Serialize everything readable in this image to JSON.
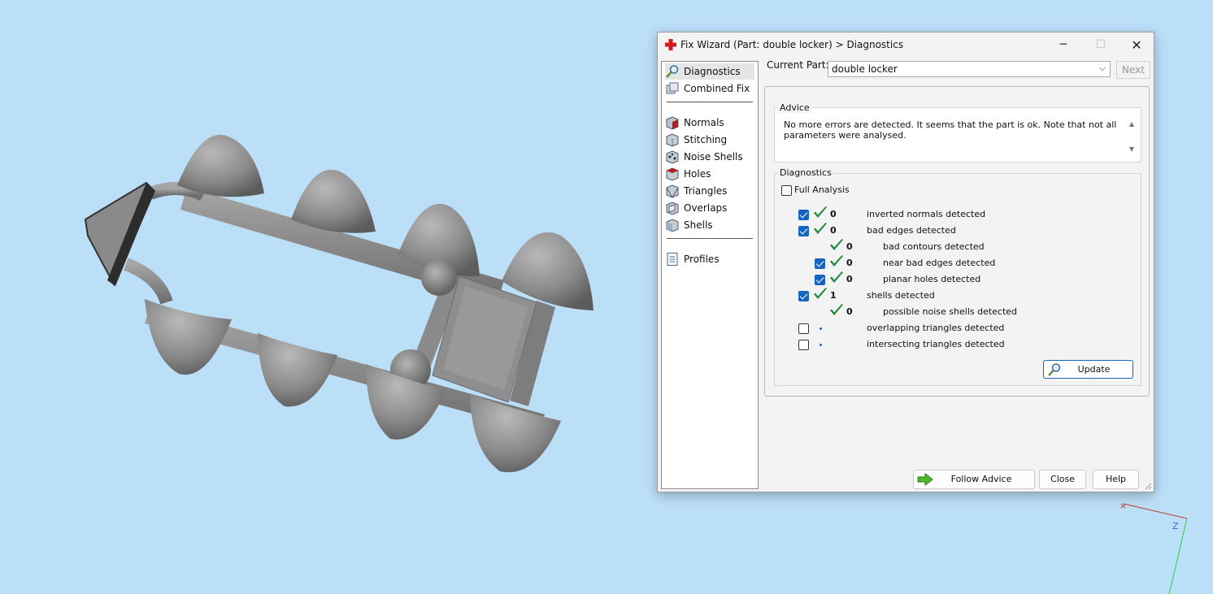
{
  "window": {
    "title": "Fix Wizard (Part: double locker) > Diagnostics",
    "app_icon": "red-cross-icon",
    "controls": {
      "minimize": "─",
      "maximize": "☐",
      "close": "✕"
    }
  },
  "sidebar": {
    "items": [
      {
        "label": "Diagnostics",
        "icon": "magnifier-icon",
        "selected": true
      },
      {
        "label": "Combined Fix",
        "icon": "combined-fix-icon"
      },
      {
        "label": "Normals",
        "icon": "normals-cube-icon"
      },
      {
        "label": "Stitching",
        "icon": "stitching-cube-icon"
      },
      {
        "label": "Noise Shells",
        "icon": "noise-shells-cube-icon"
      },
      {
        "label": "Holes",
        "icon": "holes-cube-icon"
      },
      {
        "label": "Triangles",
        "icon": "triangles-cube-icon"
      },
      {
        "label": "Overlaps",
        "icon": "overlaps-cube-icon"
      },
      {
        "label": "Shells",
        "icon": "shells-cube-icon"
      },
      {
        "label": "Profiles",
        "icon": "document-icon"
      }
    ]
  },
  "current_part": {
    "label": "Current Part:",
    "value": "double locker",
    "next_label": "Next"
  },
  "advice": {
    "title": "Advice",
    "text": "No more errors are detected. It seems that the part is ok. Note that not all parameters were analysed."
  },
  "diagnostics": {
    "title": "Diagnostics",
    "full_analysis_label": "Full Analysis",
    "full_analysis_checked": false,
    "rows": [
      {
        "checkbox": "checked",
        "status": "ok",
        "count": "0",
        "label": "inverted normals detected"
      },
      {
        "checkbox": "checked",
        "status": "ok",
        "count": "0",
        "label": "bad edges detected"
      },
      {
        "checkbox": "none",
        "status": "ok",
        "count": "0",
        "label": "bad contours detected"
      },
      {
        "checkbox": "checked",
        "status": "ok",
        "count": "0",
        "label": "near bad edges detected"
      },
      {
        "checkbox": "checked",
        "status": "ok",
        "count": "0",
        "label": "planar holes detected"
      },
      {
        "checkbox": "checked",
        "status": "ok",
        "count": "1",
        "label": "shells detected"
      },
      {
        "checkbox": "none",
        "status": "ok",
        "count": "0",
        "label": "possible noise shells detected"
      },
      {
        "checkbox": "unchecked",
        "status": "not-run",
        "count": "",
        "label": "overlapping triangles detected"
      },
      {
        "checkbox": "unchecked",
        "status": "not-run",
        "count": "",
        "label": "intersecting triangles detected"
      }
    ],
    "update_label": "Update"
  },
  "footer": {
    "follow_advice_label": "Follow Advice",
    "close_label": "Close",
    "help_label": "Help"
  },
  "axis": {
    "z_label": "Z"
  },
  "colors": {
    "viewport_bg": "#bcdff8",
    "model_gray": "#8f8f8f",
    "check_green": "#1e8a3c",
    "accent_blue": "#1565c0"
  }
}
